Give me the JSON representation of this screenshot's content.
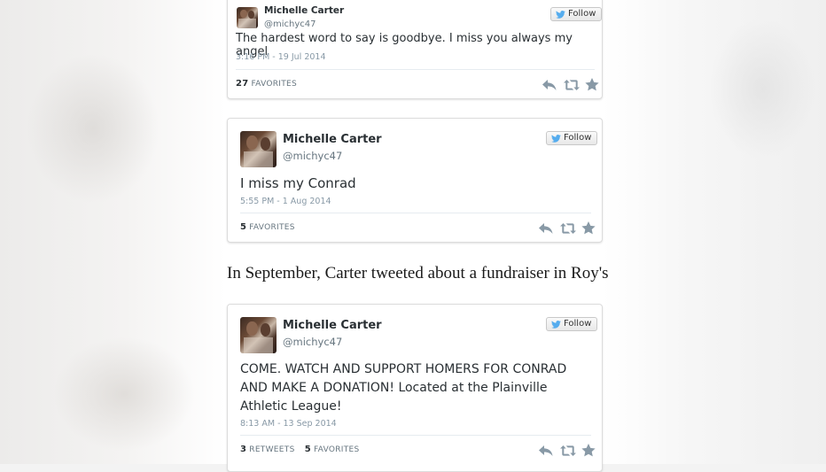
{
  "tweets": [
    {
      "name": "Michelle Carter",
      "handle": "@michyc47",
      "follow_label": "Follow",
      "text": "The hardest word to say is goodbye. I miss you always my angel",
      "time": "3:16 PM - 19 Jul 2014",
      "retweets_count": "",
      "retweets_label": "",
      "favorites_count": "27",
      "favorites_label": "FAVORITES"
    },
    {
      "name": "Michelle Carter",
      "handle": "@michyc47",
      "follow_label": "Follow",
      "text": "I miss my Conrad",
      "time": "5:55 PM - 1 Aug 2014",
      "retweets_count": "",
      "retweets_label": "",
      "favorites_count": "5",
      "favorites_label": "FAVORITES"
    },
    {
      "name": "Michelle Carter",
      "handle": "@michyc47",
      "follow_label": "Follow",
      "text": "COME. WATCH AND SUPPORT HOMERS FOR CONRAD AND MAKE A DONATION! Located at the Plainville Athletic League!",
      "time": "8:13 AM - 13 Sep 2014",
      "retweets_count": "3",
      "retweets_label": "RETWEETS",
      "favorites_count": "5",
      "favorites_label": "FAVORITES"
    }
  ],
  "caption": "In September, Carter tweeted about a fundraiser in Roy's",
  "icons": [
    "twitter-bird-icon",
    "reply-icon",
    "retweet-icon",
    "favorite-icon"
  ],
  "colors": {
    "twitter_blue": "#55acee",
    "action_gray": "#8899a6"
  }
}
